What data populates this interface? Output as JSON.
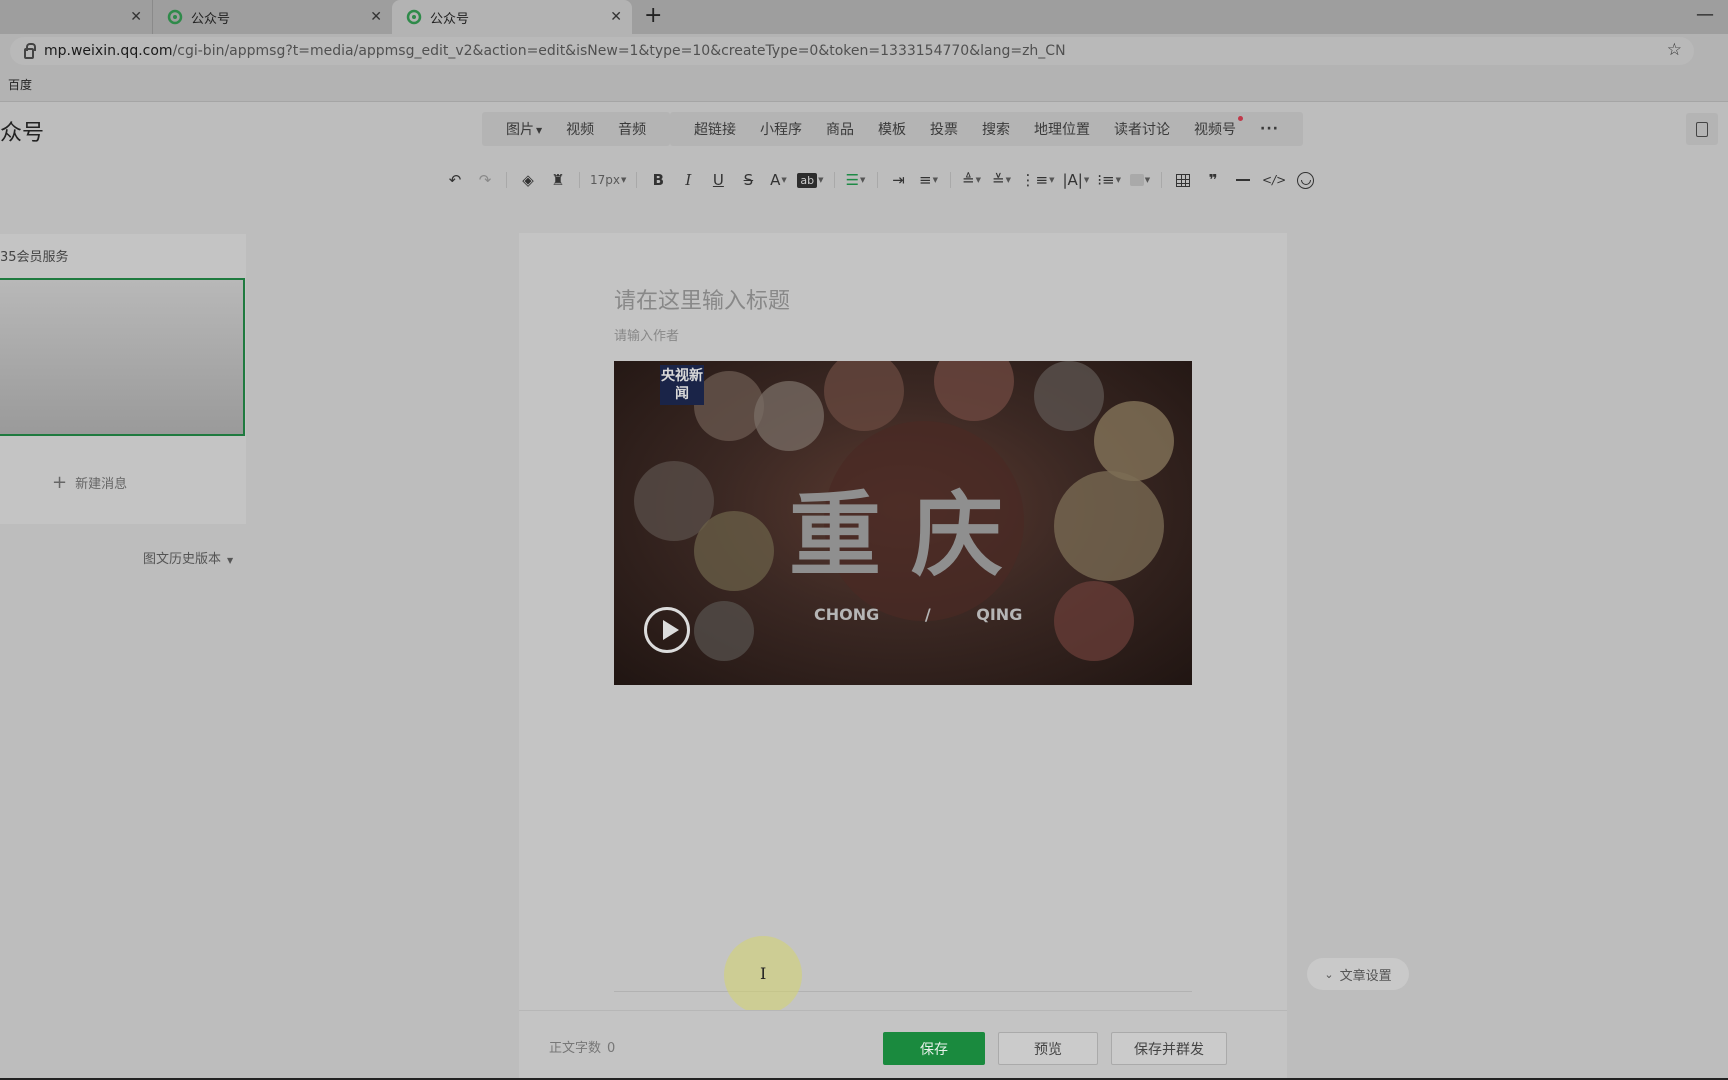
{
  "browser": {
    "tabs": [
      {
        "title": ""
      },
      {
        "title": "公众号"
      },
      {
        "title": "公众号"
      }
    ],
    "new_tab_label": "+",
    "url_host": "mp.weixin.qq.com",
    "url_path": "/cgi-bin/appmsg?t=media/appmsg_edit_v2&action=edit&isNew=1&type=10&createType=0&token=1333154770&lang=zh_CN",
    "bookmark": "百度"
  },
  "header": {
    "brand": "众号",
    "insert_group1": [
      "图片",
      "视频",
      "音频"
    ],
    "insert_group2": [
      "超链接",
      "小程序",
      "商品",
      "模板",
      "投票",
      "搜索",
      "地理位置",
      "读者讨论",
      "视频号"
    ],
    "more": "···"
  },
  "toolbar": {
    "font_size": "17px",
    "bold": "B",
    "italic": "I",
    "underline": "U",
    "strike": "S",
    "font_color": "A",
    "bg_color": "ab",
    "quote": "❞",
    "code": "</>"
  },
  "sidebar": {
    "account_name": "35会员服务",
    "new_message": "新建消息",
    "history": "图文历史版本"
  },
  "editor": {
    "title_placeholder": "请在这里输入标题",
    "author_placeholder": "请输入作者",
    "video": {
      "logo": "央视新闻",
      "title": "重庆",
      "subtitle": "CHONG / QING"
    }
  },
  "article_settings": "文章设置",
  "footer": {
    "wordcount_label": "正文字数",
    "wordcount_value": "0",
    "save": "保存",
    "preview": "预览",
    "save_publish": "保存并群发"
  },
  "colors": {
    "accent_green": "#1a8a3e",
    "notification_red": "#c0394a"
  }
}
